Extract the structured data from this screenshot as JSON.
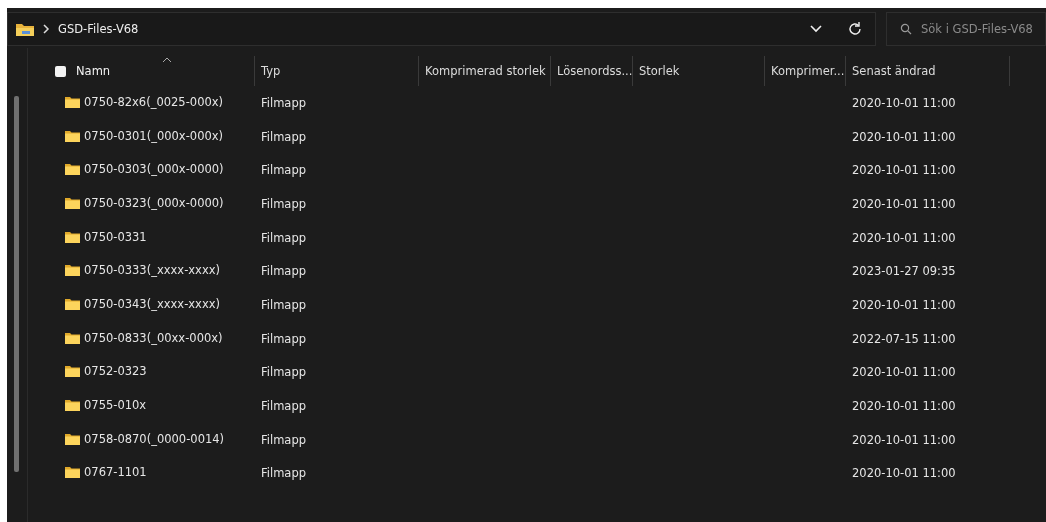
{
  "address_bar": {
    "path": "GSD-Files-V68"
  },
  "search": {
    "placeholder": "Sök i GSD-Files-V68"
  },
  "table": {
    "select_all": {
      "checked": false
    },
    "columns": [
      {
        "label": "Namn",
        "sorted": true
      },
      {
        "label": "Typ",
        "sorted": false
      },
      {
        "label": "Komprimerad storlek",
        "sorted": false
      },
      {
        "label": "Lösenordss...",
        "sorted": false
      },
      {
        "label": "Storlek",
        "sorted": false
      },
      {
        "label": "Komprimer...",
        "sorted": false
      },
      {
        "label": "Senast ändrad",
        "sorted": false
      }
    ],
    "rows": [
      {
        "name": "0750-82x6(_0025-000x)",
        "type": "Filmapp",
        "modified": "2020-10-01 11:00"
      },
      {
        "name": "0750-0301(_000x-000x)",
        "type": "Filmapp",
        "modified": "2020-10-01 11:00"
      },
      {
        "name": "0750-0303(_000x-0000)",
        "type": "Filmapp",
        "modified": "2020-10-01 11:00"
      },
      {
        "name": "0750-0323(_000x-0000)",
        "type": "Filmapp",
        "modified": "2020-10-01 11:00"
      },
      {
        "name": "0750-0331",
        "type": "Filmapp",
        "modified": "2020-10-01 11:00"
      },
      {
        "name": "0750-0333(_xxxx-xxxx)",
        "type": "Filmapp",
        "modified": "2023-01-27 09:35"
      },
      {
        "name": "0750-0343(_xxxx-xxxx)",
        "type": "Filmapp",
        "modified": "2020-10-01 11:00"
      },
      {
        "name": "0750-0833(_00xx-000x)",
        "type": "Filmapp",
        "modified": "2022-07-15 11:00"
      },
      {
        "name": "0752-0323",
        "type": "Filmapp",
        "modified": "2020-10-01 11:00"
      },
      {
        "name": "0755-010x",
        "type": "Filmapp",
        "modified": "2020-10-01 11:00"
      },
      {
        "name": "0758-0870(_0000-0014)",
        "type": "Filmapp",
        "modified": "2020-10-01 11:00"
      },
      {
        "name": "0767-1101",
        "type": "Filmapp",
        "modified": "2020-10-01 11:00"
      }
    ]
  }
}
